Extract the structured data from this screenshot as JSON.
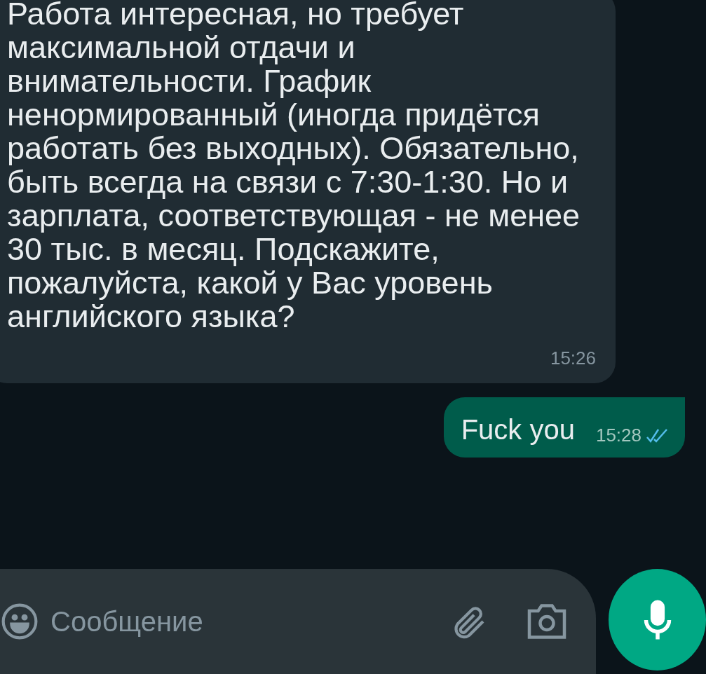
{
  "messages": [
    {
      "kind": "incoming",
      "text": "Работа интересная, но требует максимальной отдачи и внимательности. График ненормированный (иногда придётся работать без выходных). Обязательно, быть всегда на связи с 7:30-1:30. Но и зарплата, соответствующая - не менее 30 тыс. в месяц. Подскажите, пожалуйста, какой у Вас уровень английского языка?",
      "time": "15:26"
    },
    {
      "kind": "outgoing",
      "text": "Fuck you",
      "time": "15:28",
      "read": true
    }
  ],
  "composer": {
    "placeholder": "Сообщение"
  }
}
